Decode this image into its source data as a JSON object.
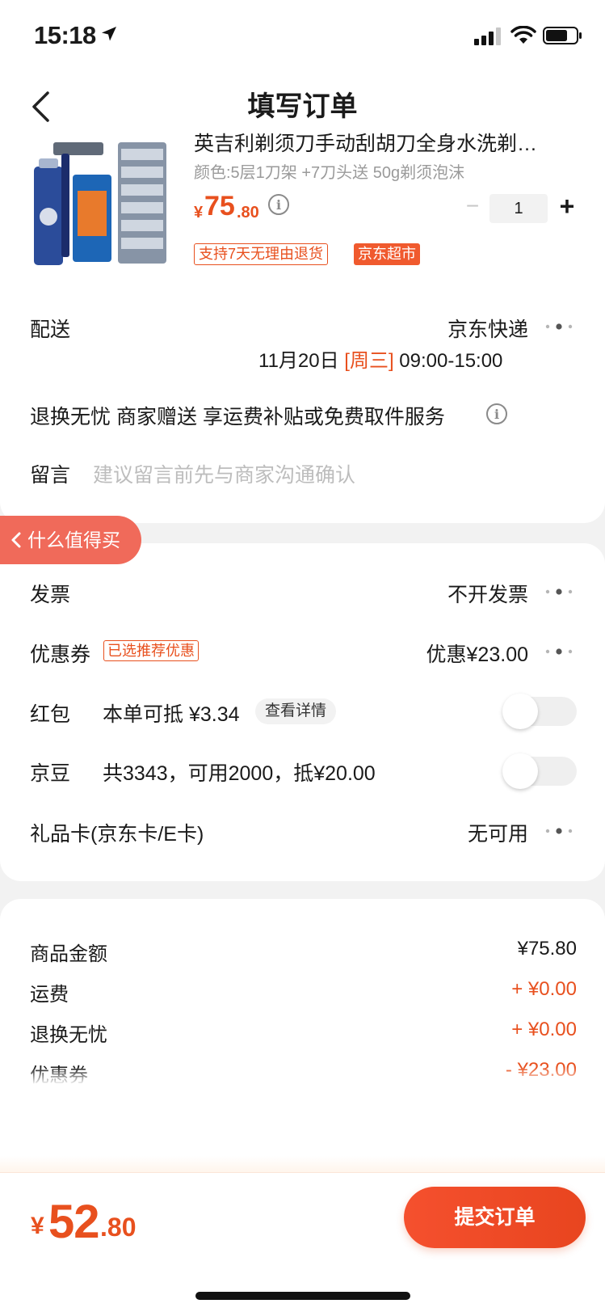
{
  "status_bar": {
    "time": "15:18"
  },
  "nav": {
    "title": "填写订单"
  },
  "product": {
    "name": "英吉利剃须刀手动刮胡刀全身水洗剃…",
    "spec": "颜色:5层1刀架 +7刀头送 50g剃须泡沫",
    "price_currency": "¥",
    "price_int": "75",
    "price_dec": ".80",
    "quantity": "1",
    "minus": "−",
    "plus": "+",
    "tags": [
      "支持7天无理由退货",
      "京东超市"
    ]
  },
  "delivery": {
    "label": "配送",
    "value": "京东快递",
    "date": "11月20日",
    "weekday": "[周三]",
    "time_window": "09:00-15:00"
  },
  "service": {
    "text": "退换无忧 商家赠送 享运费补贴或免费取件服务"
  },
  "note": {
    "label": "留言",
    "placeholder": "建议留言前先与商家沟通确认"
  },
  "floating": {
    "label": "什么值得买"
  },
  "invoice": {
    "label": "发票",
    "value": "不开发票"
  },
  "coupon": {
    "label": "优惠券",
    "tag": "已选推荐优惠",
    "value": "优惠¥23.00"
  },
  "red_packet": {
    "label": "红包",
    "text": "本单可抵 ¥3.34",
    "chip": "查看详情",
    "enabled": false
  },
  "jd_beans": {
    "label": "京豆",
    "text": "共3343，可用2000，抵¥20.00",
    "enabled": false
  },
  "gift_card": {
    "label": "礼品卡(京东卡/E卡)",
    "value": "无可用"
  },
  "summary": [
    {
      "label": "商品金额",
      "value": "¥75.80"
    },
    {
      "label": "运费",
      "value": "+ ¥0.00"
    },
    {
      "label": "退换无忧",
      "value": "+ ¥0.00"
    },
    {
      "label": "优惠券",
      "value": "- ¥23.00"
    }
  ],
  "total": {
    "currency": "¥",
    "int": "52",
    "dec": ".80"
  },
  "submit": {
    "label": "提交订单"
  },
  "colors": {
    "accent": "#e8501e",
    "pill": "#f06a5a",
    "background": "#f2f2f2"
  },
  "icons": [
    "location-arrow-icon",
    "signal-icon",
    "wifi-icon",
    "battery-icon",
    "back-chevron-icon",
    "info-icon",
    "more-dots-icon",
    "chevron-left-icon"
  ]
}
